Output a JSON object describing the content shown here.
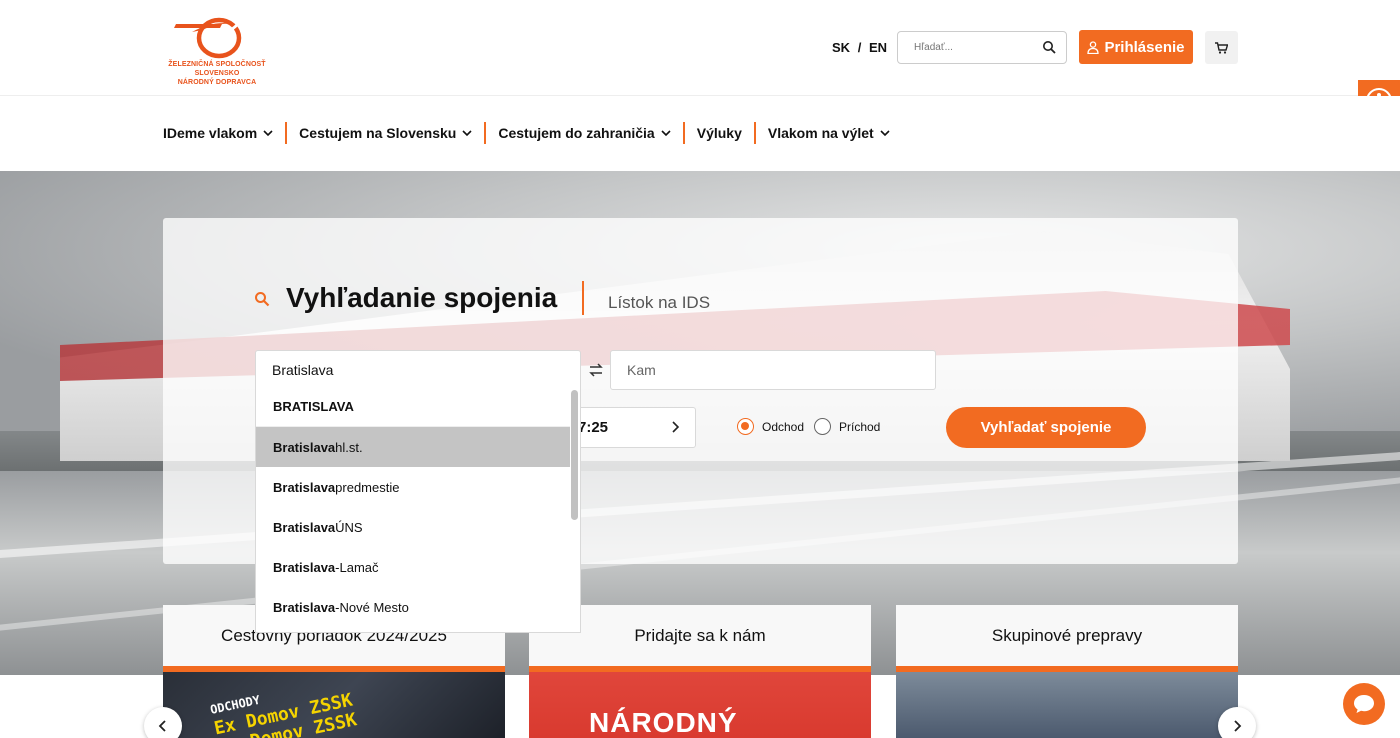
{
  "header": {
    "logo_line1": "ŽELEZNIČNÁ SPOLOČNOSŤ SLOVENSKO",
    "logo_line2": "NÁRODNÝ DOPRAVCA",
    "lang_sk": "SK",
    "lang_sep": "/",
    "lang_en": "EN",
    "search_placeholder": "Hľadať...",
    "login_label": "Prihlásenie"
  },
  "nav": {
    "items": [
      {
        "label": "IDeme vlakom",
        "has_dropdown": true
      },
      {
        "label": "Cestujem na Slovensku",
        "has_dropdown": true
      },
      {
        "label": "Cestujem do zahraničia",
        "has_dropdown": true
      },
      {
        "label": "Výluky",
        "has_dropdown": false
      },
      {
        "label": "Vlakom na výlet",
        "has_dropdown": true
      }
    ]
  },
  "search": {
    "title": "Vyhľadanie spojenia",
    "tab_ids": "Lístok na IDS",
    "from_value": "Bratislava",
    "to_placeholder": "Kam",
    "time_value": "7:25",
    "radio_departure": "Odchod",
    "radio_arrival": "Príchod",
    "departure_selected": true,
    "submit_label": "Vyhľadať spojenie"
  },
  "dropdown": {
    "items": [
      {
        "bold": "BRATISLAVA",
        "rest": "",
        "active": false
      },
      {
        "bold": "Bratislava",
        "rest": " hl.st.",
        "active": true
      },
      {
        "bold": "Bratislava",
        "rest": " predmestie",
        "active": false
      },
      {
        "bold": "Bratislava",
        "rest": " ÚNS",
        "active": false
      },
      {
        "bold": "Bratislava",
        "rest": "-Lamač",
        "active": false
      },
      {
        "bold": "Bratislava",
        "rest": "-Nové Mesto",
        "active": false
      }
    ]
  },
  "cards": [
    {
      "title": "Cestovný poriadok 2024/2025"
    },
    {
      "title": "Pridajte sa k nám"
    },
    {
      "title": "Skupinové prepravy"
    }
  ],
  "card_images": {
    "board_line1": "ODCHODY",
    "board_line2": "Ex Domov ZSSK",
    "board_line3": "Ex Domov ZSSK",
    "card2_text": "NÁRODNÝ DOPRAVCA"
  },
  "colors": {
    "accent": "#f26b21",
    "text": "#111111"
  }
}
